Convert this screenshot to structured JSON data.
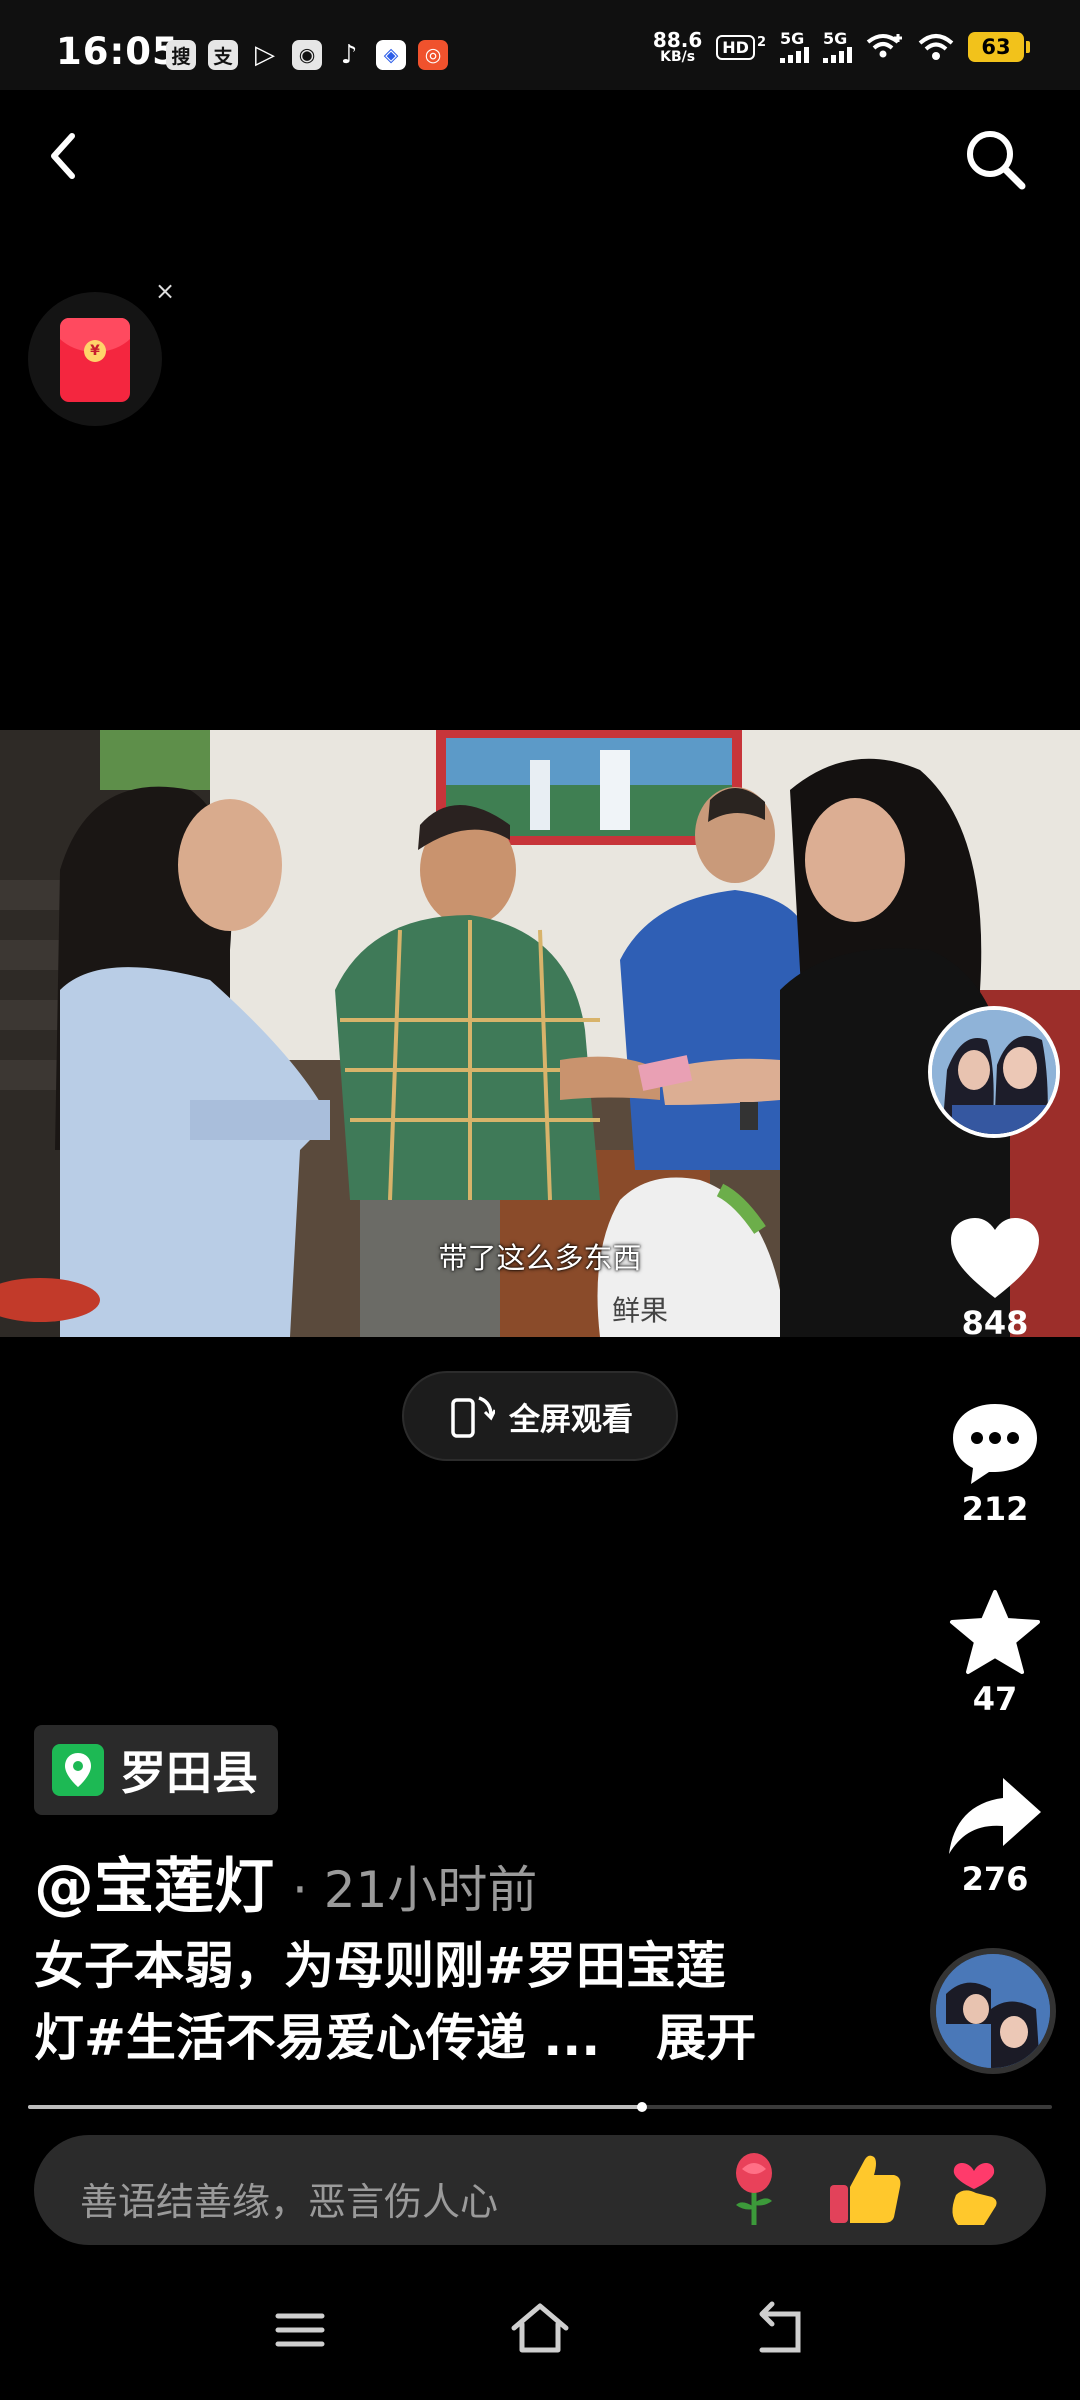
{
  "status_bar": {
    "time": "16:05",
    "app_icons": [
      "搜",
      "支",
      "▷",
      "◉",
      "♪",
      "◈",
      "◎"
    ],
    "net_speed_value": "88.6",
    "net_speed_unit": "KB/s",
    "hd_label": "HD",
    "hd_sub": "2",
    "sim1": "5G",
    "sim2": "5G",
    "battery": "63"
  },
  "video": {
    "subtitle": "带了这么多东西",
    "bag_text": "鲜果"
  },
  "fullscreen": {
    "label": "全屏观看"
  },
  "actions": {
    "likes": "848",
    "comments": "212",
    "favorites": "47",
    "shares": "276"
  },
  "info": {
    "location": "罗田县",
    "author": "@宝莲灯",
    "time": "· 21小时前",
    "desc_line1": "女子本弱，为母则刚#罗田宝莲",
    "desc_line2": "灯#生活不易爱心传递 ...",
    "expand": "展开",
    "progress": 0.6
  },
  "comment_bar": {
    "placeholder": "善语结善缘，恶言伤人心",
    "emojis": [
      "rose-emoji",
      "thumbs-up-emoji",
      "finger-heart-emoji"
    ]
  },
  "colors": {
    "accent": "#1db954",
    "red_packet": "#f4263f",
    "like": "#ffffff"
  }
}
